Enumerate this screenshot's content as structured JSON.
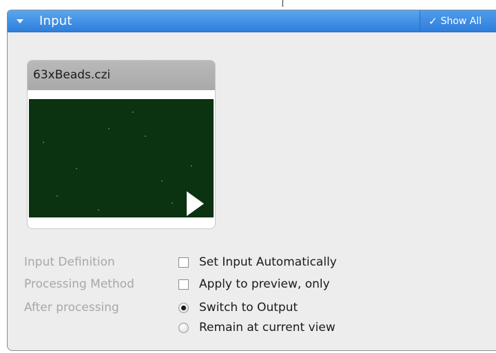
{
  "panel": {
    "title": "Input",
    "show_all_label": "Show All"
  },
  "thumbnail": {
    "file_name": "63xBeads.czi"
  },
  "settings": {
    "input_definition": {
      "label": "Input Definition",
      "option": "Set Input Automatically",
      "checked": false
    },
    "processing_method": {
      "label": "Processing Method",
      "option": "Apply to preview, only",
      "checked": false
    },
    "after_processing": {
      "label": "After processing",
      "options": [
        "Switch to Output",
        "Remain at current view"
      ],
      "selected": "Switch to Output"
    }
  },
  "icons": [
    "collapse-arrow-icon",
    "checkmark-icon",
    "play-icon"
  ],
  "colors": {
    "header_blue": "#3b8ae3",
    "panel_bg": "#ededed",
    "image_bg": "#0b3211"
  }
}
